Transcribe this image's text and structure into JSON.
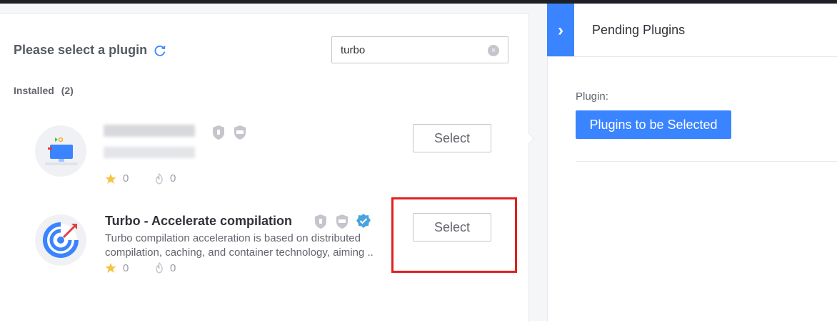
{
  "header": {
    "title": "Please select a plugin",
    "search_value": "turbo",
    "search_clear_label": "×"
  },
  "installed": {
    "label": "Installed",
    "count": "(2)"
  },
  "plugins": [
    {
      "name": "",
      "description": "",
      "stars": "0",
      "installs": "0",
      "select_label": "Select"
    },
    {
      "name": "Turbo - Accelerate compilation",
      "description": "Turbo compilation acceleration is based on distributed compilation, caching, and container technology, aiming ..",
      "stars": "0",
      "installs": "0",
      "select_label": "Select"
    }
  ],
  "right_panel": {
    "title": "Pending Plugins",
    "collapse_icon": "›",
    "plugin_label": "Plugin:",
    "plugin_chip": "Plugins to be Selected"
  },
  "colors": {
    "accent": "#3a84ff",
    "highlight": "#e02020",
    "star": "#f5c342"
  }
}
